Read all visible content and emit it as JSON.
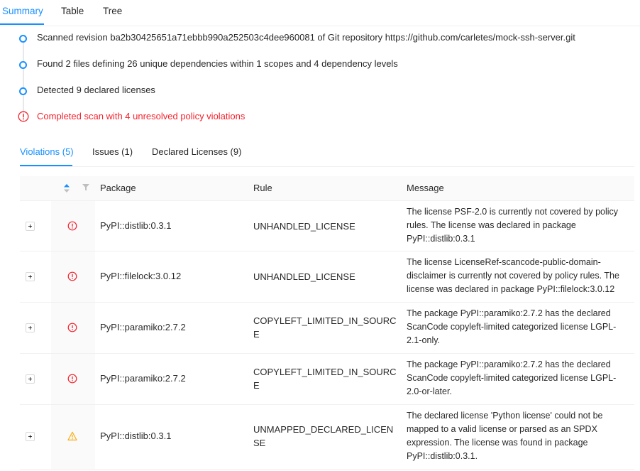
{
  "top_tabs": [
    {
      "label": "Summary"
    },
    {
      "label": "Table"
    },
    {
      "label": "Tree"
    }
  ],
  "timeline": [
    {
      "text": "Scanned revision ba2b30425651a71ebbb990a252503c4dee960081 of Git repository https://github.com/carletes/mock-ssh-server.git",
      "status": "info"
    },
    {
      "text": "Found 2 files defining 26 unique dependencies within 1 scopes and 4 dependency levels",
      "status": "info"
    },
    {
      "text": "Detected 9 declared licenses",
      "status": "info"
    },
    {
      "text": "Completed scan with 4 unresolved policy violations",
      "status": "error"
    }
  ],
  "inner_tabs": [
    {
      "label": "Violations (5)"
    },
    {
      "label": "Issues (1)"
    },
    {
      "label": "Declared Licenses (9)"
    }
  ],
  "table": {
    "headers": {
      "package": "Package",
      "rule": "Rule",
      "message": "Message"
    },
    "rows": [
      {
        "severity": "error",
        "package": "PyPI::distlib:0.3.1",
        "rule": "UNHANDLED_LICENSE",
        "message": "The license PSF-2.0 is currently not covered by policy rules. The license was declared in package PyPI::distlib:0.3.1"
      },
      {
        "severity": "error",
        "package": "PyPI::filelock:3.0.12",
        "rule": "UNHANDLED_LICENSE",
        "message": "The license LicenseRef-scancode-public-domain-disclaimer is currently not covered by policy rules. The license was declared in package PyPI::filelock:3.0.12"
      },
      {
        "severity": "error",
        "package": "PyPI::paramiko:2.7.2",
        "rule": "COPYLEFT_LIMITED_IN_SOURCE",
        "message": "The package PyPI::paramiko:2.7.2 has the declared ScanCode copyleft-limited categorized license LGPL-2.1-only."
      },
      {
        "severity": "error",
        "package": "PyPI::paramiko:2.7.2",
        "rule": "COPYLEFT_LIMITED_IN_SOURCE",
        "message": "The package PyPI::paramiko:2.7.2 has the declared ScanCode copyleft-limited categorized license LGPL-2.0-or-later."
      },
      {
        "severity": "warning",
        "package": "PyPI::distlib:0.3.1",
        "rule": "UNMAPPED_DECLARED_LICENSE",
        "message": "The declared license 'Python license' could not be mapped to a valid license or parsed as an SPDX expression. The license was found in package PyPI::distlib:0.3.1."
      }
    ]
  },
  "colors": {
    "accent": "#1890ff",
    "error": "#f5222d",
    "warning": "#faad14"
  }
}
